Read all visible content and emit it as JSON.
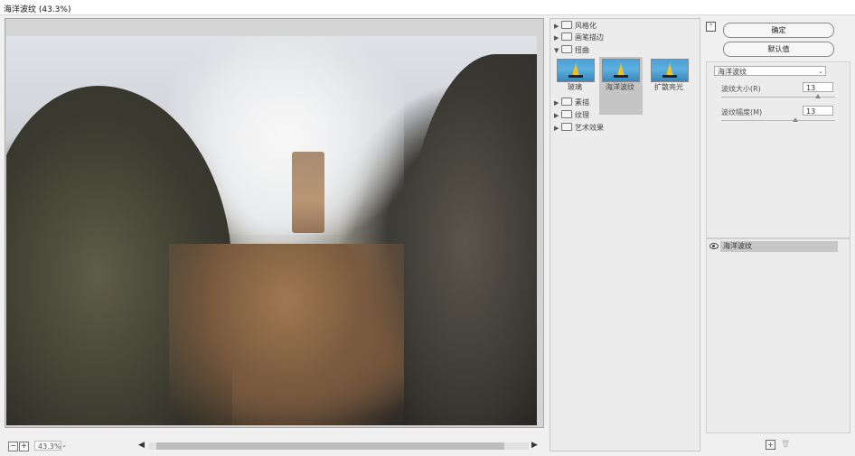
{
  "window": {
    "title": "海洋波纹 (43.3%)"
  },
  "preview": {
    "zoom": "43.3%"
  },
  "filter_gallery": {
    "categories": [
      {
        "label": "风格化",
        "expanded": false
      },
      {
        "label": "画笔描边",
        "expanded": false
      },
      {
        "label": "扭曲",
        "expanded": true
      },
      {
        "label": "素描",
        "expanded": false
      },
      {
        "label": "纹理",
        "expanded": false
      },
      {
        "label": "艺术效果",
        "expanded": false
      }
    ],
    "thumbnails": [
      {
        "label": "玻璃",
        "selected": false
      },
      {
        "label": "海洋波纹",
        "selected": true
      },
      {
        "label": "扩散亮光",
        "selected": false
      }
    ]
  },
  "buttons": {
    "ok": "确定",
    "default": "默认值"
  },
  "settings": {
    "filter_select": "海洋波纹",
    "params": [
      {
        "label": "波纹大小(R)",
        "value": "13"
      },
      {
        "label": "波纹幅度(M)",
        "value": "13"
      }
    ]
  },
  "effect_layers": [
    {
      "label": "海洋波纹"
    }
  ],
  "colors": {
    "selected_bg": "#c5c5c5",
    "panel_bg": "#ececec"
  }
}
